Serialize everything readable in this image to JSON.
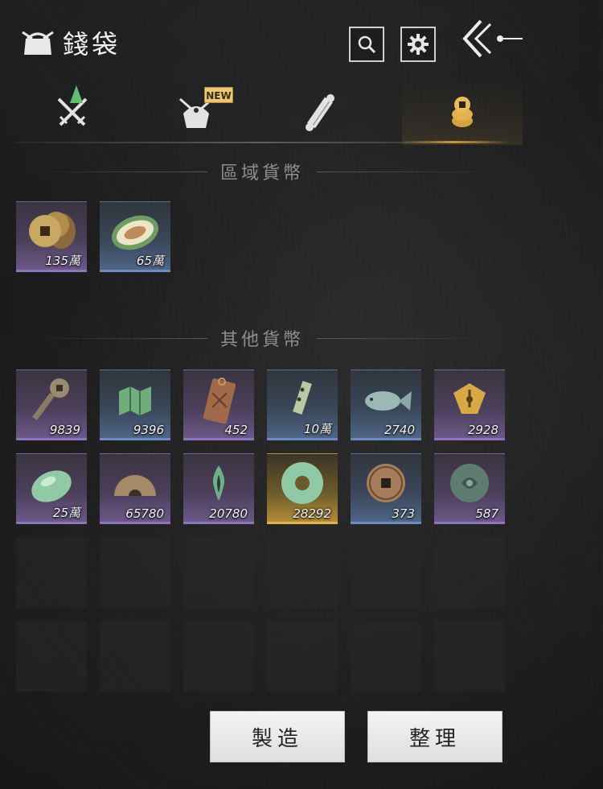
{
  "header": {
    "title": "錢袋",
    "icons": {
      "pouch": "money-pouch-icon",
      "search": "search-icon",
      "settings": "gear-icon",
      "back": "back-arrow-icon"
    }
  },
  "tabs": [
    {
      "name": "equipment",
      "icon": "crossed-swords-icon",
      "indicator": "up-arrow"
    },
    {
      "name": "bag",
      "icon": "bundle-icon",
      "badge": "NEW"
    },
    {
      "name": "scrolls",
      "icon": "scroll-icon"
    },
    {
      "name": "currency",
      "icon": "coin-stack-icon",
      "active": true
    }
  ],
  "sections": {
    "regional": {
      "heading": "區域貨幣",
      "items": [
        {
          "icon": "copper-coins-icon",
          "count": "135萬",
          "rarity": "purple"
        },
        {
          "icon": "melon-icon",
          "count": "65萬",
          "rarity": "blue"
        }
      ]
    },
    "other": {
      "heading": "其他貨幣",
      "items": [
        {
          "icon": "sword-coin-icon",
          "count": "9839",
          "rarity": "purple"
        },
        {
          "icon": "jade-map-icon",
          "count": "9396",
          "rarity": "blue"
        },
        {
          "icon": "bronze-tag-icon",
          "count": "452",
          "rarity": "purple"
        },
        {
          "icon": "token-slip-icon",
          "count": "10萬",
          "rarity": "blue"
        },
        {
          "icon": "jade-fish-icon",
          "count": "2740",
          "rarity": "blue"
        },
        {
          "icon": "gold-pen-icon",
          "count": "2928",
          "rarity": "purple"
        },
        {
          "icon": "jade-stone-icon",
          "count": "25萬",
          "rarity": "purple"
        },
        {
          "icon": "half-coin-icon",
          "count": "65780",
          "rarity": "purple"
        },
        {
          "icon": "green-flame-icon",
          "count": "20780",
          "rarity": "purple"
        },
        {
          "icon": "jade-disc-icon",
          "count": "28292",
          "rarity": "gold"
        },
        {
          "icon": "ancient-coin-icon",
          "count": "373",
          "rarity": "blue"
        },
        {
          "icon": "mossy-coin-icon",
          "count": "587",
          "rarity": "purple"
        }
      ]
    }
  },
  "buttons": {
    "craft": "製造",
    "sort": "整理"
  },
  "colors": {
    "purple": "#6e5a8c",
    "blue": "#50688a",
    "gold": "#b8913a",
    "accent": "#c99a3d"
  }
}
